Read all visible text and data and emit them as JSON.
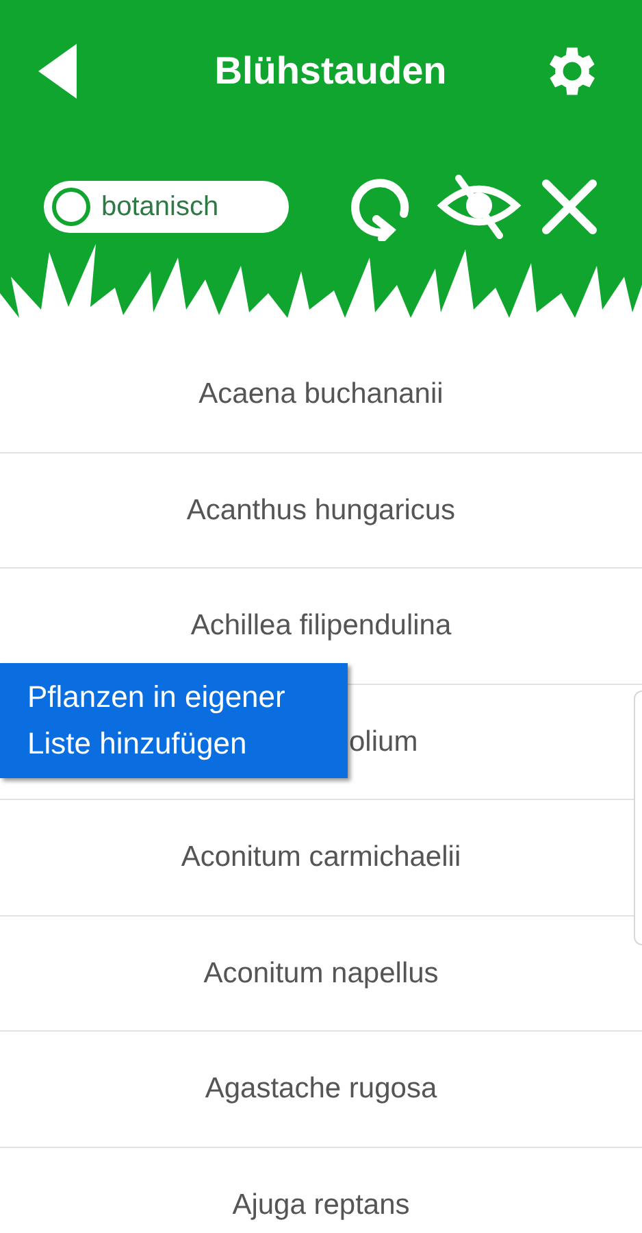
{
  "header": {
    "title": "Blühstauden"
  },
  "toggle": {
    "label": "botanisch",
    "on": false
  },
  "rows": [
    {
      "text": "Acaena buchananii"
    },
    {
      "text": "Acanthus hungaricus"
    },
    {
      "text": "Achillea filipendulina"
    },
    {
      "text": "olium",
      "covered": true
    },
    {
      "text": "Aconitum carmichaelii"
    },
    {
      "text": "Aconitum napellus"
    },
    {
      "text": "Agastache rugosa"
    },
    {
      "text": "Ajuga reptans"
    }
  ],
  "tooltip": {
    "text": "Pflanzen in eigener Liste hinzufügen"
  }
}
